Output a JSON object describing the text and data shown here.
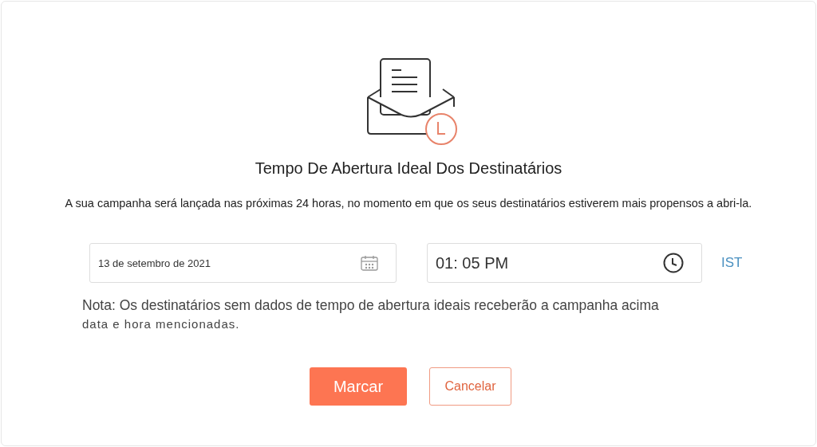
{
  "title": "Tempo De Abertura Ideal Dos Destinatários",
  "description": "A sua campanha será lançada nas próximas 24 horas, no momento em que os seus destinatários estiverem mais propensos a abri-la.",
  "date_field": {
    "value": "13 de setembro de 2021"
  },
  "time_field": {
    "value": "01: 05 PM"
  },
  "timezone": "IST",
  "note": [
    "Nota: Os destinatários sem dados de tempo de abertura ideais receberão a campanha acima",
    "data e hora mencionadas."
  ],
  "buttons": [
    {
      "label": "Marcar",
      "kind": "primary"
    },
    {
      "label": "Cancelar",
      "kind": "secondary"
    }
  ]
}
